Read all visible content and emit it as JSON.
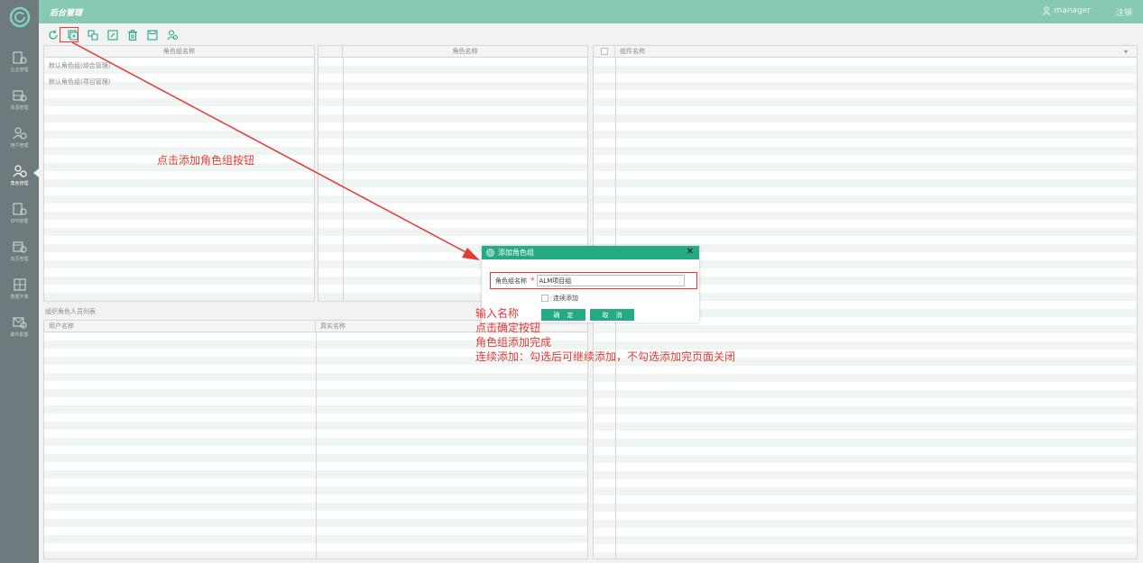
{
  "app": {
    "title": "后台管理",
    "username": "manager",
    "logout": "注销"
  },
  "sidebar": {
    "items": [
      {
        "label": "企业管理",
        "icon": "enterprise-icon"
      },
      {
        "label": "资源管理",
        "icon": "resource-icon"
      },
      {
        "label": "用户管理",
        "icon": "user-icon"
      },
      {
        "label": "角色管理",
        "icon": "role-icon",
        "active": true
      },
      {
        "label": "EPS管理",
        "icon": "eps-icon"
      },
      {
        "label": "日历管理",
        "icon": "calendar-icon"
      },
      {
        "label": "数据字典",
        "icon": "dictionary-icon"
      },
      {
        "label": "邮件配置",
        "icon": "mail-icon"
      }
    ]
  },
  "toolbar": {
    "icons": [
      "refresh-icon",
      "add-group-icon",
      "add-role-icon",
      "edit-icon",
      "delete-icon",
      "save-icon",
      "assign-user-icon"
    ]
  },
  "group_panel": {
    "header": "角色组名称",
    "rows": [
      "默认角色组(综合管理)",
      "默认角色组(项目管理)"
    ]
  },
  "role_panel": {
    "header": "角色名称"
  },
  "component_panel": {
    "header": "组件名称"
  },
  "members": {
    "title": "组织角色人员列表",
    "columns": [
      "用户名称",
      "真实名称"
    ]
  },
  "dialog": {
    "title": "添加角色组",
    "field_label": "角色组名称",
    "required_mark": "*",
    "field_value": "ALM项目组",
    "continue_label": "连续添加",
    "ok_label": "确定",
    "cancel_label": "取消"
  },
  "annotations": {
    "click_add": "点击添加角色组按钮",
    "lines": [
      "输入名称",
      "点击确定按钮",
      "角色组添加完成",
      "连续添加：勾选后可继续添加，不勾选添加完页面关闭"
    ]
  },
  "colors": {
    "accent": "#26a985",
    "topbar": "#88c9b3",
    "sidebar": "#6e7a7d",
    "annotation": "#e53935"
  }
}
